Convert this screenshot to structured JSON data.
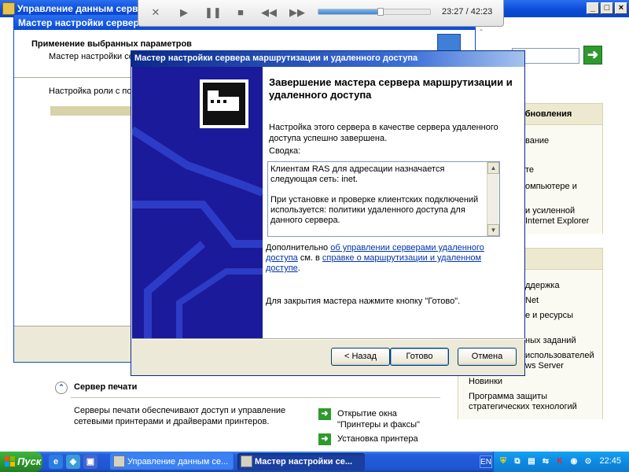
{
  "media_player": {
    "time_current": "23:27",
    "time_separator": " / ",
    "time_total": "42:23",
    "progress_fraction": 0.553
  },
  "bg_window": {
    "title": "Управление данным серве",
    "right_panel": {
      "section1_title": "обновления",
      "section1_links": [
        "вание",
        "те",
        "омпьютере и",
        "и усиленной",
        "Internet Explorer"
      ],
      "section2_links": [
        "ддержка",
        "Net",
        "е и ресурсы",
        "ных заданий",
        "использователей",
        "ws Server",
        "Новинки",
        "Программа защиты",
        "стратегических технологий"
      ]
    },
    "print_server": {
      "title": "Сервер печати",
      "description": "Серверы печати обеспечивают доступ и управление сетевыми принтерами и драйверами принтеров.",
      "actions": [
        "Открытие окна \"Принтеры и факсы\"",
        "Установка принтера"
      ]
    }
  },
  "cys_window": {
    "title": "Мастер настройки сервера",
    "heading": "Применение выбранных параметров",
    "subheading": "Мастер настройки се",
    "status": "Настройка роли с по"
  },
  "dialog": {
    "title": "Мастер настройки сервера маршрутизации и удаленного доступа",
    "heading": "Завершение мастера сервера маршрутизации и удаленного доступа",
    "intro": "Настройка этого сервера в качестве сервера удаленного доступа успешно завершена.",
    "summary_label": "Сводка:",
    "summary_p1": "Клиентам RAS для адресации назначается следующая сеть: inet.",
    "summary_p2": "При установке и проверке клиентских подключений используется: политики удаленного доступа для данного сервера.",
    "more_prefix": "Дополнительно ",
    "more_link1": "об управлении серверами удаленного доступа",
    "more_middle": " см. в ",
    "more_link2": "справке о маршрутизации и удаленном доступе",
    "more_suffix": ".",
    "close_text": "Для закрытия мастера нажмите кнопку \"Готово\".",
    "back_button": "< Назад",
    "finish_button": "Готово",
    "cancel_button": "Отмена"
  },
  "taskbar": {
    "start_label": "Пуск",
    "tasks": [
      "Управление данным се...",
      "Мастер настройки се..."
    ],
    "language": "EN",
    "clock": "22:45"
  },
  "colors": {
    "title_blue": "#0a4ad6",
    "wizard_side": "#1a1a9a",
    "taskbar_blue": "#245edb",
    "start_green": "#2e9a2e"
  }
}
